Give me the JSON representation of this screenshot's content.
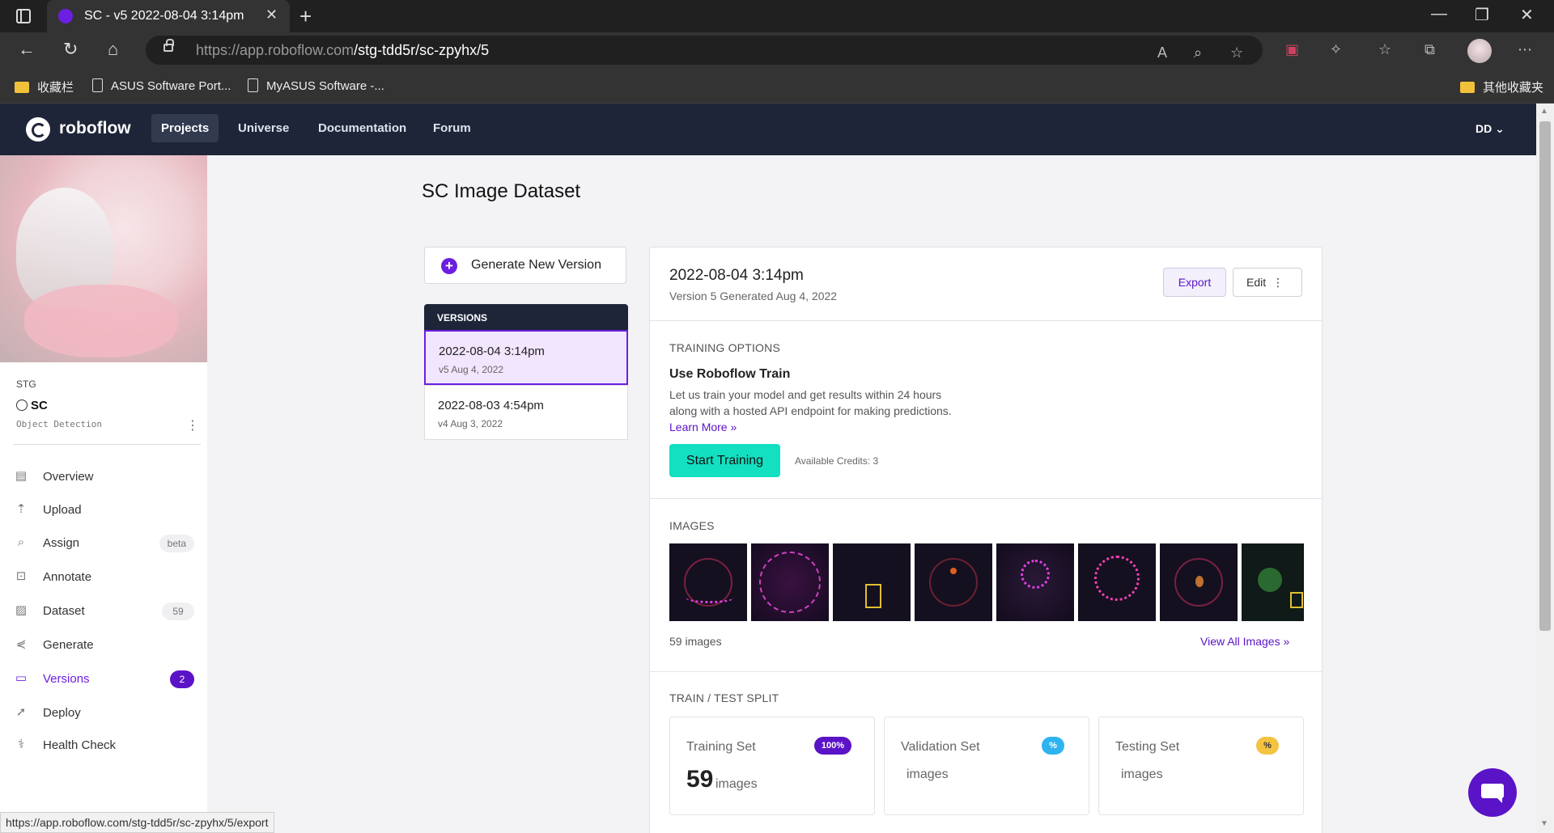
{
  "browser": {
    "tab_title": "SC - v5 2022-08-04 3:14pm",
    "tab_close": "✕",
    "new_tab": "+",
    "url_host": "https://app.roboflow.com",
    "url_path": "/stg-tdd5r/sc-zpyhx/5",
    "bookmarks": [
      "收藏栏",
      "ASUS Software Port...",
      "MyASUS Software -...",
      "其他收藏夹"
    ]
  },
  "nav": {
    "logo": "roboflow",
    "items": [
      "Projects",
      "Universe",
      "Documentation",
      "Forum"
    ],
    "user": "DD"
  },
  "sidebar": {
    "workspace": "STG",
    "project": "SC",
    "project_type": "Object Detection",
    "items": [
      {
        "label": "Overview",
        "icon": "overview-icon"
      },
      {
        "label": "Upload",
        "icon": "upload-icon"
      },
      {
        "label": "Assign",
        "icon": "search-icon",
        "badge": "beta"
      },
      {
        "label": "Annotate",
        "icon": "annotate-icon"
      },
      {
        "label": "Dataset",
        "icon": "dataset-icon",
        "badge": "59"
      },
      {
        "label": "Generate",
        "icon": "generate-icon"
      },
      {
        "label": "Versions",
        "icon": "versions-icon",
        "badge": "2"
      },
      {
        "label": "Deploy",
        "icon": "rocket-icon"
      },
      {
        "label": "Health Check",
        "icon": "stethoscope-icon"
      }
    ]
  },
  "page": {
    "title": "SC Image Dataset",
    "generate_label": "Generate New Version",
    "versions_header": "VERSIONS",
    "versions": [
      {
        "title": "2022-08-04 3:14pm",
        "sub": "v5 Aug 4, 2022"
      },
      {
        "title": "2022-08-03 4:54pm",
        "sub": "v4 Aug 3, 2022"
      }
    ]
  },
  "version_detail": {
    "title": "2022-08-04 3:14pm",
    "subtitle": "Version 5 Generated Aug 4, 2022",
    "export": "Export",
    "edit": "Edit",
    "training_label": "TRAINING OPTIONS",
    "training_title": "Use Roboflow Train",
    "training_desc": "Let us train your model and get results within 24 hours along with a hosted API endpoint for making predictions.",
    "learn_more": "Learn More »",
    "start_training": "Start Training",
    "credits": "Available Credits: 3",
    "images_label": "IMAGES",
    "image_count": "59 images",
    "view_all": "View All Images »",
    "split_label": "TRAIN / TEST SPLIT",
    "splits": [
      {
        "name": "Training Set",
        "badge": "100%",
        "count": "59",
        "unit": "images",
        "color": "#5b13c7"
      },
      {
        "name": "Validation Set",
        "badge": "%",
        "count": "",
        "unit": "images",
        "color": "#2eb3f0"
      },
      {
        "name": "Testing Set",
        "badge": "%",
        "count": "",
        "unit": "images",
        "color": "#f5c342"
      }
    ]
  },
  "status_url": "https://app.roboflow.com/stg-tdd5r/sc-zpyhx/5/export"
}
